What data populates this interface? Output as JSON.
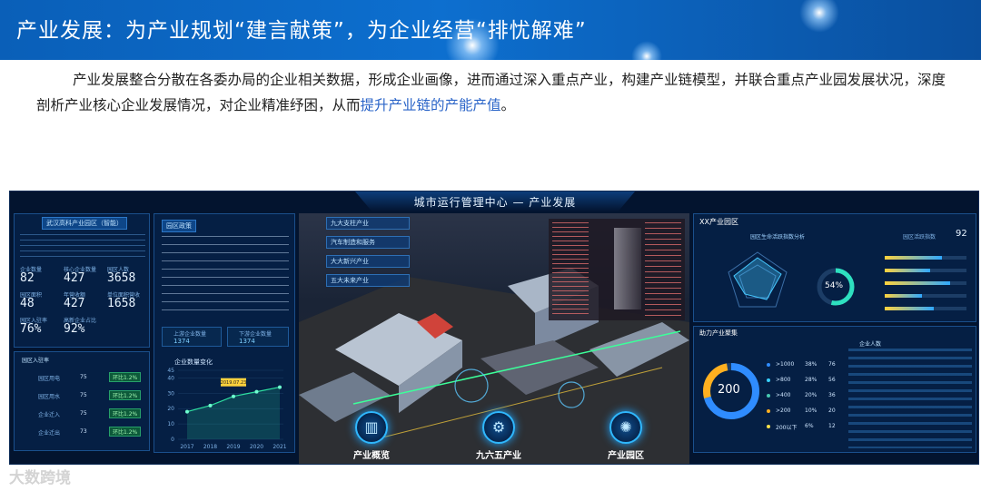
{
  "banner": {
    "title": "产业发展：为产业规划“建言献策”，为企业经营“排忧解难”"
  },
  "intro": {
    "text_before": "产业发展整合分散在各委办局的企业相关数据，形成企业画像，进而通过深入重点产业，构建产业链模型，并联合重点产业园发展状况，深度剖析产业核心企业发展情况，对企业精准纾困，从而",
    "highlight": "提升产业链的产能产值",
    "text_after": "。"
  },
  "dashboard": {
    "title": "城市运行管理中心 — 产业发展",
    "left_panel": {
      "title": "武汉高科产业园区（智能）",
      "stats": [
        {
          "label": "企业数量",
          "value": "82"
        },
        {
          "label": "核心企业数量",
          "value": "427"
        },
        {
          "label": "园区人数",
          "value": "3658"
        },
        {
          "label": "园区面积",
          "value": "48"
        },
        {
          "label": "年营收额",
          "value": "427"
        },
        {
          "label": "单位面积营收",
          "value": "1658"
        },
        {
          "label": "园区入驻率",
          "value": "76%"
        },
        {
          "label": "高新企业占比",
          "value": "92%"
        }
      ],
      "entry_title": "园区入驻率",
      "entry_rows": [
        {
          "label": "园区用电",
          "value": "75",
          "badge": "环比1.2%"
        },
        {
          "label": "园区用水",
          "value": "75",
          "badge": "环比1.2%"
        },
        {
          "label": "企业迁入",
          "value": "75",
          "badge": "环比1.2%"
        },
        {
          "label": "企业迁出",
          "value": "73",
          "badge": "环比1.2%"
        }
      ]
    },
    "policy_panel": {
      "title": "园区政策",
      "up_label": "上游企业数量",
      "up_value": "1374",
      "down_label": "下游企业数量",
      "down_value": "1374",
      "chart_title": "企业数量变化",
      "chart_badge": "2019.07.23"
    },
    "center": {
      "industry_tabs": [
        "九大支柱产业",
        "汽车制造和服务",
        "大大新兴产业",
        "五大未来产业"
      ],
      "nav": [
        {
          "label": "产业概览",
          "icon": "building-icon"
        },
        {
          "label": "九六五产业",
          "icon": "network-icon"
        },
        {
          "label": "产业园区",
          "icon": "radar-icon"
        }
      ]
    },
    "right_panel": {
      "title": "XX产业园区",
      "analysis_tab": "园区生命活跃指数分析",
      "score_label": "园区活跃指数",
      "score_value": "92",
      "gauge_value": "54%",
      "help_title": "助力产业聚集",
      "donut_value": "200",
      "legend": [
        {
          "label": ">1000",
          "pct": "38%",
          "n": "76",
          "color": "#2f8cff"
        },
        {
          "label": ">800",
          "pct": "28%",
          "n": "56",
          "color": "#38d0ff"
        },
        {
          "label": ">400",
          "pct": "20%",
          "n": "36",
          "color": "#48c9b0"
        },
        {
          "label": ">200",
          "pct": "10%",
          "n": "20",
          "color": "#ffb020"
        },
        {
          "label": "200以下",
          "pct": "6%",
          "n": "12",
          "color": "#ffe14a"
        }
      ],
      "table_header": "企业人数"
    }
  },
  "chart_data": {
    "type": "line",
    "title": "企业数量变化",
    "categories": [
      "2017",
      "2018",
      "2019",
      "2020",
      "2021"
    ],
    "values": [
      18,
      22,
      28,
      31,
      34
    ],
    "ylim": [
      0,
      45
    ],
    "yticks": [
      "45",
      "40",
      "30",
      "20",
      "10",
      "0"
    ],
    "color": "#2ee0a0"
  },
  "watermark": {
    "text": "大数跨境"
  }
}
